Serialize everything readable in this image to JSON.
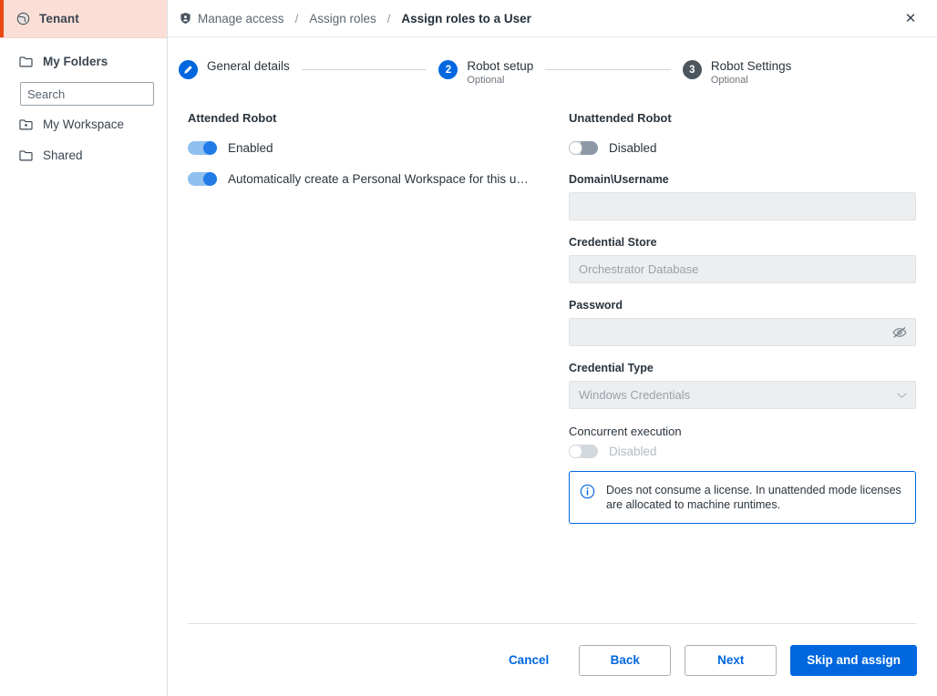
{
  "sidebar": {
    "tenant": {
      "label": "Tenant",
      "icon": "globe-icon"
    },
    "my_folders": {
      "label": "My Folders",
      "icon": "folder-icon"
    },
    "search": {
      "placeholder": "Search",
      "value": "",
      "icon": "search-icon"
    },
    "folders": [
      {
        "label": "My Workspace",
        "icon": "workspace-folder-icon"
      },
      {
        "label": "Shared",
        "icon": "folder-icon"
      }
    ]
  },
  "header": {
    "breadcrumb": [
      {
        "label": "Manage access",
        "icon": "shield-user-icon",
        "current": false
      },
      {
        "label": "Assign roles",
        "current": false
      },
      {
        "label": "Assign roles to a User",
        "current": true
      }
    ],
    "separator": "/",
    "close_label": "✕"
  },
  "stepper": {
    "steps": [
      {
        "marker": "✎",
        "state": "done",
        "title": "General details",
        "subtitle": ""
      },
      {
        "marker": "2",
        "state": "active",
        "title": "Robot setup",
        "subtitle": "Optional"
      },
      {
        "marker": "3",
        "state": "idle",
        "title": "Robot Settings",
        "subtitle": "Optional"
      }
    ]
  },
  "attended": {
    "section_title": "Attended Robot",
    "enabled_toggle": {
      "label": "Enabled",
      "state": "on"
    },
    "workspace_toggle": {
      "label": "Automatically create a Personal Workspace for this u…",
      "state": "on"
    }
  },
  "unattended": {
    "section_title": "Unattended Robot",
    "enabled_toggle": {
      "label": "Disabled",
      "state": "off"
    },
    "domain_username": {
      "label": "Domain\\Username",
      "value": "",
      "placeholder": ""
    },
    "credential_store": {
      "label": "Credential Store",
      "value": "",
      "placeholder": "Orchestrator Database"
    },
    "password": {
      "label": "Password",
      "value": "",
      "placeholder": "",
      "icon": "eye-off-icon"
    },
    "credential_type": {
      "label": "Credential Type",
      "value": "",
      "placeholder": "Windows Credentials",
      "icon": "chevron-down-icon"
    },
    "concurrent_execution": {
      "label": "Concurrent execution",
      "toggle_label": "Disabled",
      "state": "off"
    },
    "alert": {
      "icon": "info-icon",
      "text": "Does not consume a license. In unattended mode licenses are allocated to machine runtimes."
    }
  },
  "footer": {
    "cancel_label": "Cancel",
    "back_label": "Back",
    "next_label": "Next",
    "skip_label": "Skip and assign"
  },
  "colors": {
    "accent_blue": "#0067df",
    "tenant_bar": "#e8490f",
    "tenant_bg": "#fbdfd6"
  }
}
